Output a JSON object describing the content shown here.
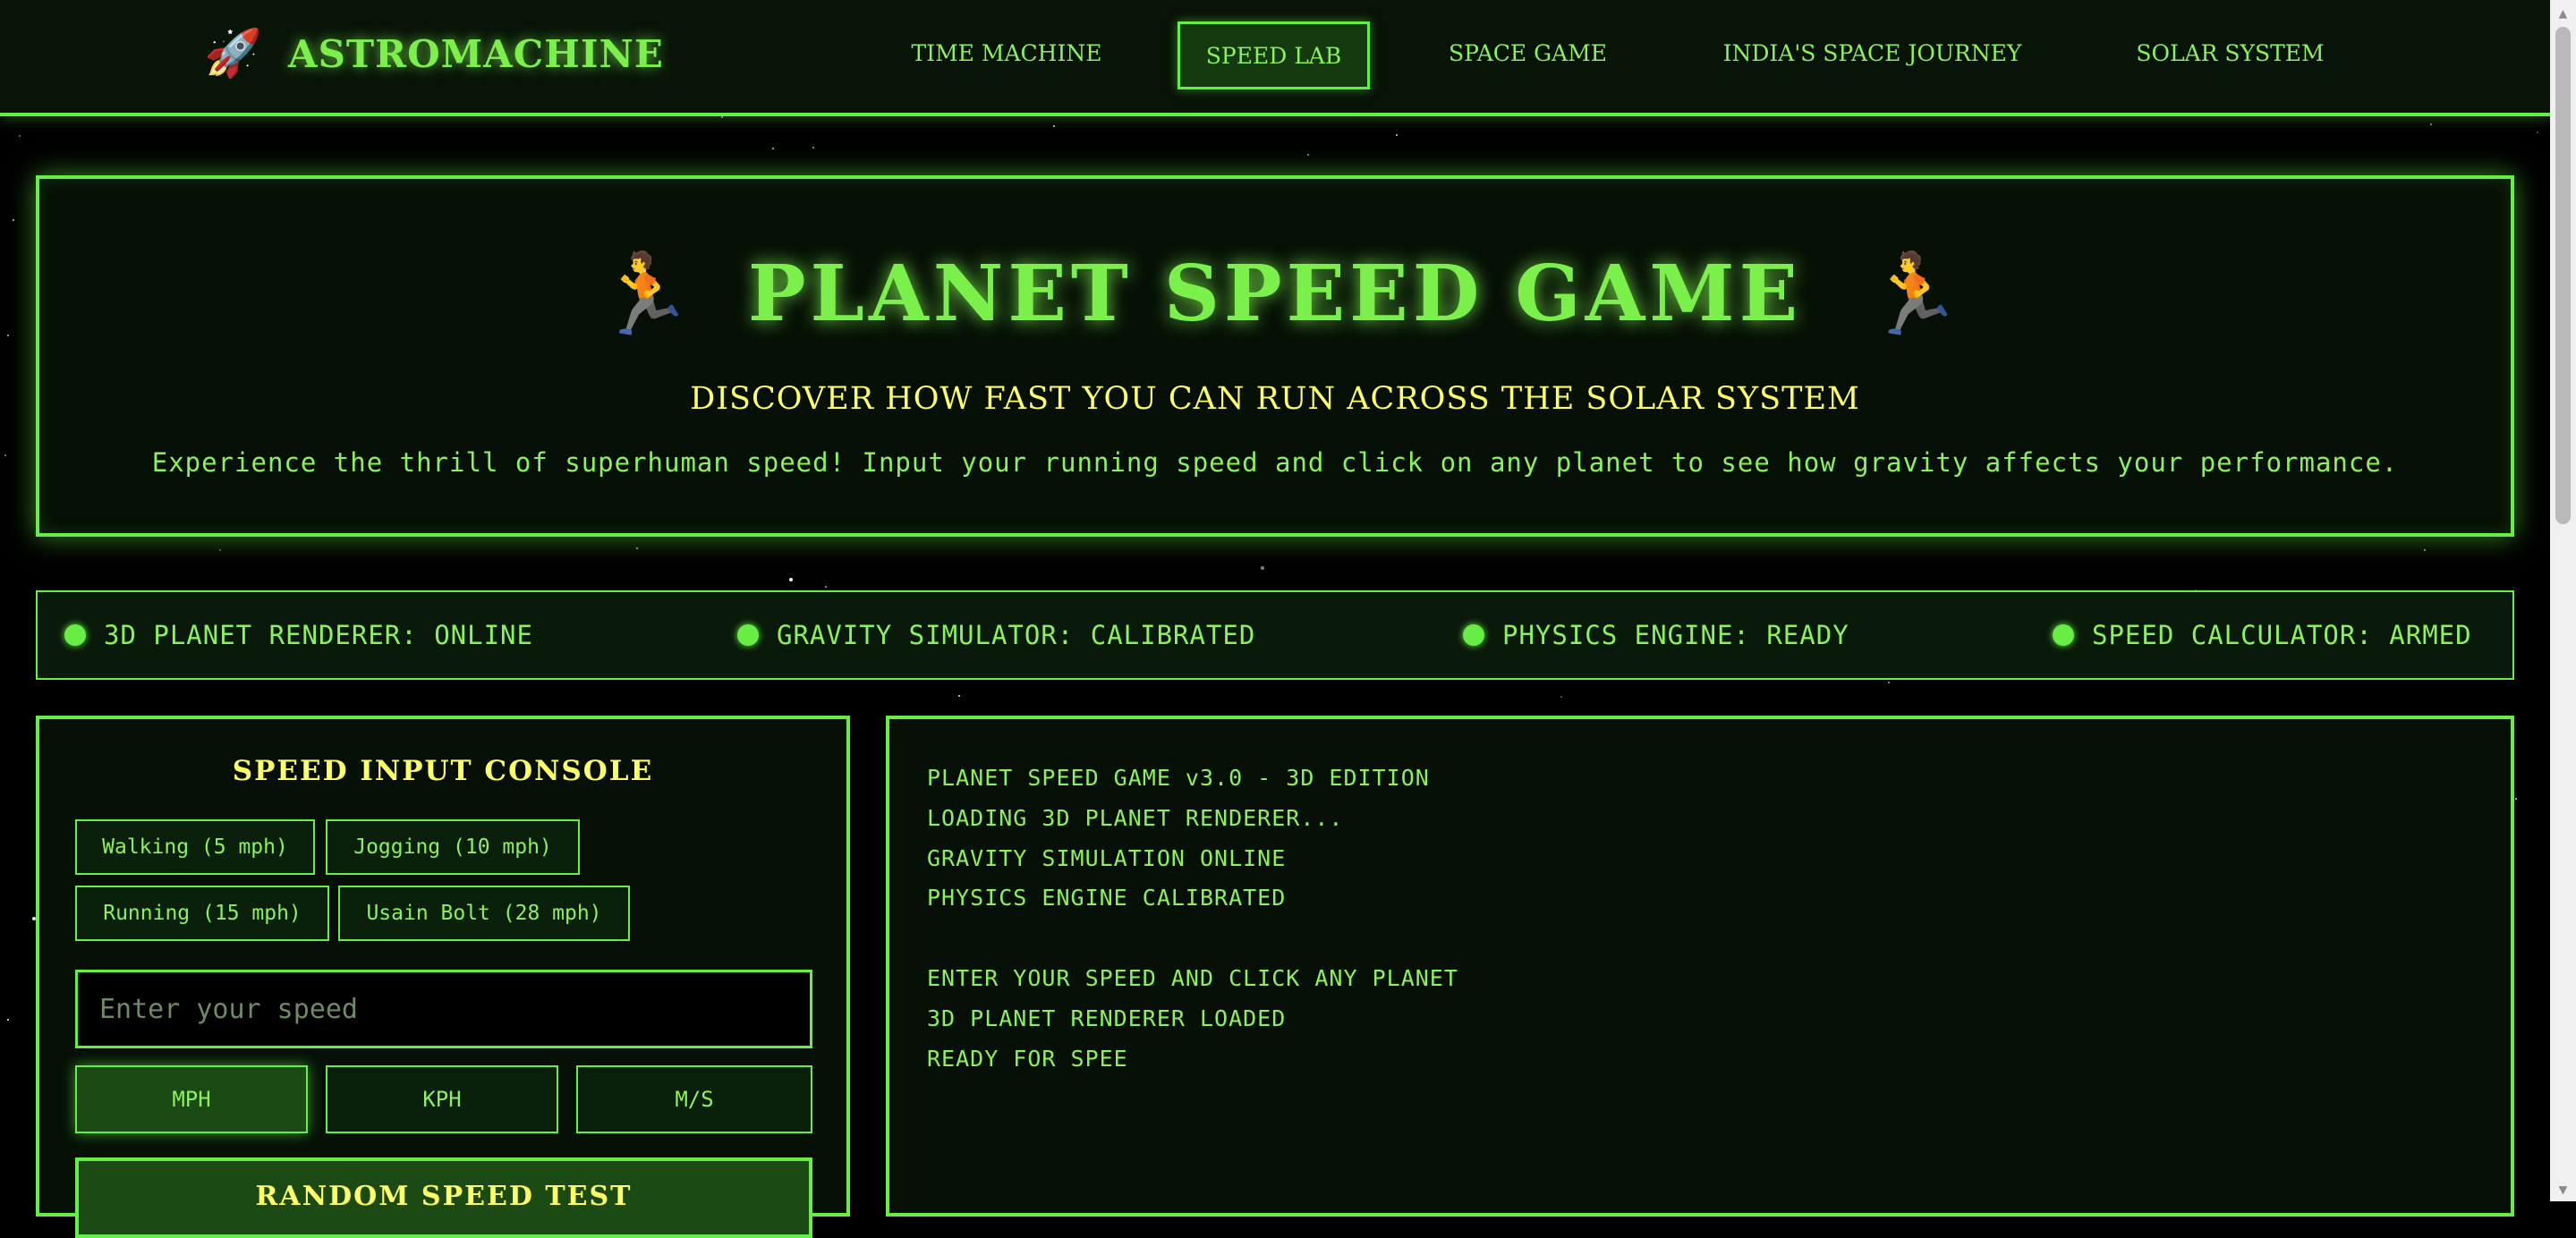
{
  "nav": {
    "brand": "ASTROMACHINE",
    "brand_icon": "rocket-icon",
    "links": [
      "TIME MACHINE",
      "SPEED LAB",
      "SPACE GAME",
      "INDIA'S SPACE JOURNEY",
      "SOLAR SYSTEM"
    ],
    "active": "SPEED LAB"
  },
  "hero": {
    "runner_icon": "runner-icon",
    "title": "PLANET SPEED GAME",
    "subtitle": "DISCOVER HOW FAST YOU CAN RUN ACROSS THE SOLAR SYSTEM",
    "description": "Experience the thrill of superhuman speed! Input your running speed and click on any planet to see how gravity affects your performance."
  },
  "status": [
    "3D PLANET RENDERER: ONLINE",
    "GRAVITY SIMULATOR: CALIBRATED",
    "PHYSICS ENGINE: READY",
    "SPEED CALCULATOR: ARMED"
  ],
  "console": {
    "title": "SPEED INPUT CONSOLE",
    "presets": [
      "Walking (5 mph)",
      "Jogging (10 mph)",
      "Running (15 mph)",
      "Usain Bolt (28 mph)"
    ],
    "input_placeholder": "Enter your speed",
    "input_value": "",
    "units": [
      "MPH",
      "KPH",
      "M/S"
    ],
    "active_unit": "MPH",
    "random_button": "RANDOM SPEED TEST"
  },
  "terminal": {
    "lines": [
      "PLANET SPEED GAME v3.0 - 3D EDITION",
      "LOADING 3D PLANET RENDERER...",
      "GRAVITY SIMULATION ONLINE",
      "PHYSICS ENGINE CALIBRATED",
      "",
      "ENTER YOUR SPEED AND CLICK ANY PLANET",
      "3D PLANET RENDERER LOADED",
      "READY FOR SPEE"
    ]
  },
  "colors": {
    "accent": "#66ee44",
    "text": "#8cf25c",
    "highlight": "#ffff66",
    "background": "#000000"
  }
}
